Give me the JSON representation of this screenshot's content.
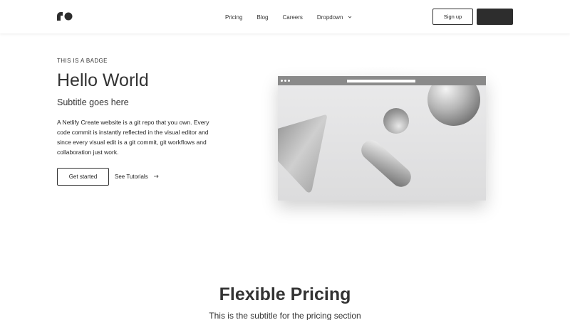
{
  "header": {
    "logo_icon": "ro-logo-icon",
    "nav": [
      {
        "label": "Pricing"
      },
      {
        "label": "Blog"
      },
      {
        "label": "Careers"
      },
      {
        "label": "Dropdown",
        "icon": "chevron-down-icon"
      }
    ],
    "signup_label": "Sign up",
    "dark_button_label": ""
  },
  "hero": {
    "badge": "THIS IS A BADGE",
    "title": "Hello World",
    "subtitle": "Subtitle goes here",
    "body": "A Netlify Create website is a git repo that you own. Every code commit is instantly reflected in the visual editor and since every visual edit is a git commit, git workflows and collaboration just work.",
    "primary_button": "Get started",
    "secondary_link": "See Tutorials",
    "secondary_icon": "arrow-right-icon"
  },
  "pricing": {
    "title": "Flexible Pricing",
    "subtitle": "This is the subtitle for the pricing section"
  },
  "colors": {
    "dark": "#2d2d2d",
    "text": "#333333",
    "mockup_bar": "#8a8a8a",
    "mockup_bg": "#e6e6e6"
  }
}
